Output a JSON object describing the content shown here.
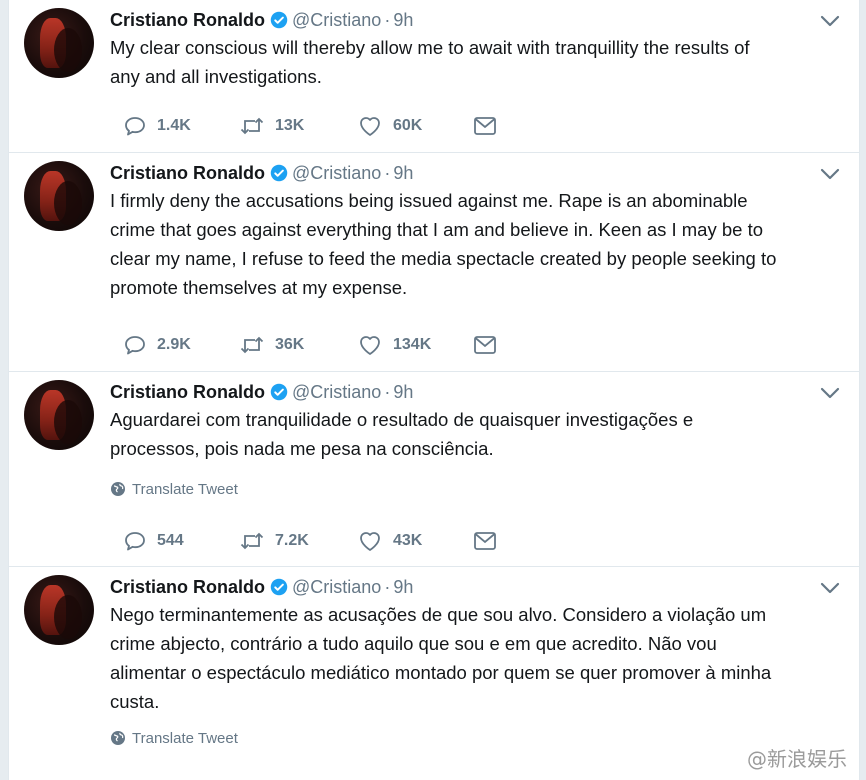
{
  "tweets": [
    {
      "name": "Cristiano Ronaldo",
      "handle": "@Cristiano",
      "sep": "·",
      "time": "9h",
      "lines": [
        "My clear conscious will thereby allow me to await with tranquillity the results of",
        "any and all investigations."
      ],
      "translate": null,
      "replies": "1.4K",
      "retweets": "13K",
      "likes": "60K"
    },
    {
      "name": "Cristiano Ronaldo",
      "handle": "@Cristiano",
      "sep": "·",
      "time": "9h",
      "lines": [
        "I firmly deny the accusations being issued against me. Rape is an abominable",
        "crime that goes against everything that I am and believe in. Keen as I may be to",
        "clear my name, I refuse to feed the media spectacle created by people seeking to",
        "promote themselves at my expense."
      ],
      "translate": null,
      "replies": "2.9K",
      "retweets": "36K",
      "likes": "134K"
    },
    {
      "name": "Cristiano Ronaldo",
      "handle": "@Cristiano",
      "sep": "·",
      "time": "9h",
      "lines": [
        "Aguardarei com tranquilidade o resultado de quaisquer investigações e",
        "processos, pois nada me pesa na consciência."
      ],
      "translate": "Translate Tweet",
      "replies": "544",
      "retweets": "7.2K",
      "likes": "43K"
    },
    {
      "name": "Cristiano Ronaldo",
      "handle": "@Cristiano",
      "sep": "·",
      "time": "9h",
      "lines": [
        "Nego terminantemente as acusações de que sou alvo. Considero a violação um",
        "crime abjecto, contrário a tudo aquilo que sou e em que acredito. Não vou",
        "alimentar o espectáculo mediático montado por quem se quer promover à minha",
        "custa."
      ],
      "translate": "Translate Tweet",
      "replies": null,
      "retweets": null,
      "likes": null
    }
  ],
  "watermark": "@新浪娱乐",
  "colors": {
    "text": "#14171a",
    "secondary": "#657786",
    "verified": "#1da1f2",
    "border": "#e1e8ed"
  }
}
